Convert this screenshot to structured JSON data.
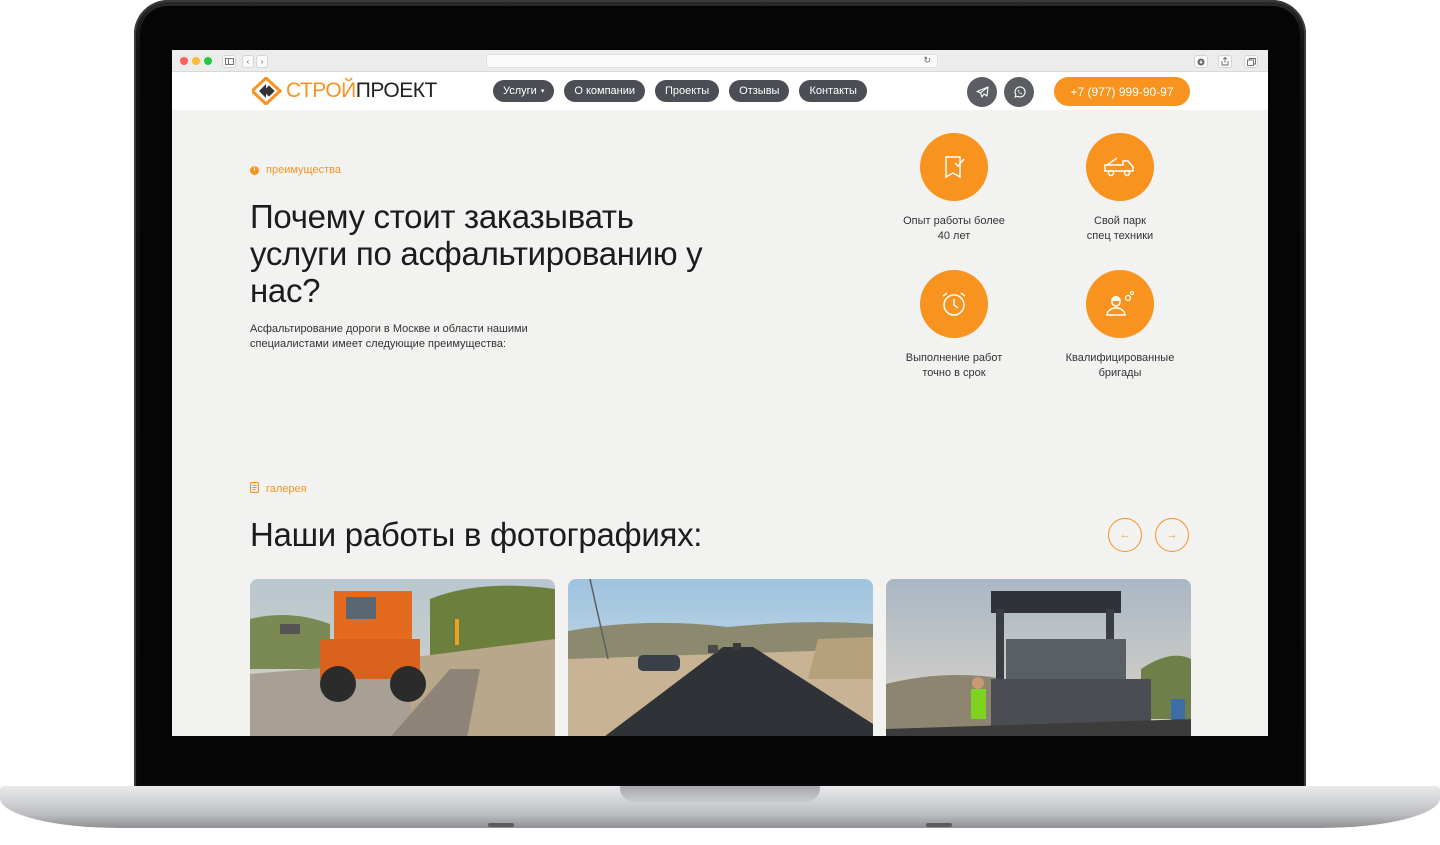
{
  "browser": {
    "nav_back": "‹",
    "nav_forward": "›",
    "reload_glyph": "↻"
  },
  "header": {
    "logo_part1": "СТРОЙ",
    "logo_part2": "ПРОЕКТ",
    "nav": [
      {
        "label": "Услуги",
        "has_dropdown": true
      },
      {
        "label": "О компании"
      },
      {
        "label": "Проекты"
      },
      {
        "label": "Отзывы"
      },
      {
        "label": "Контакты"
      }
    ],
    "caret": "▾",
    "telegram_icon": "telegram-icon",
    "whatsapp_icon": "whatsapp-icon",
    "phone": "+7 (977) 999-90-97"
  },
  "advantages": {
    "tag": "преимущества",
    "title": "Почему стоит заказывать услуги по асфальтированию у нас?",
    "lead": "Асфальтирование дороги в Москве и области нашими специалистами имеет следующие преимущества:",
    "features": [
      {
        "icon": "flag-check-icon",
        "label": "Опыт работы более\n40 лет"
      },
      {
        "icon": "tow-truck-icon",
        "label": "Свой парк\nспец техники"
      },
      {
        "icon": "alarm-clock-icon",
        "label": "Выполнение работ\nточно в срок"
      },
      {
        "icon": "worker-gears-icon",
        "label": "Квалифицированные\nбригады"
      }
    ]
  },
  "gallery": {
    "tag": "галерея",
    "title": "Наши работы в фотографиях:",
    "prev_glyph": "←",
    "next_glyph": "→",
    "photos": [
      {
        "subject": "orange road grader on dirt road"
      },
      {
        "subject": "fresh asphalt road with parked car"
      },
      {
        "subject": "titan asphalt paver with workers"
      }
    ]
  },
  "colors": {
    "accent": "#f7931e",
    "nav_pill": "#4b4f55",
    "page_bg": "#f2f2f0"
  }
}
